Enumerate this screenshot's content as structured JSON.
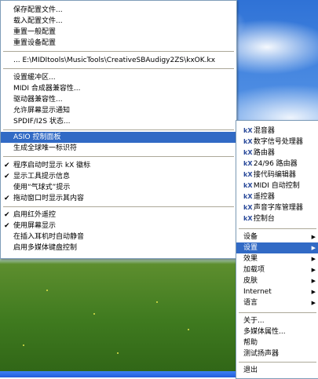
{
  "left_menu": {
    "items": [
      {
        "label": "保存配置文件..."
      },
      {
        "label": "载入配置文件..."
      },
      {
        "label": "重置一般配置"
      },
      {
        "label": "重置设备配置"
      },
      {
        "label": "... E:\\MIDItools\\MusicTools\\CreativeSBAudigy2ZS\\kxOK.kx"
      },
      {
        "label": "设置缓冲区..."
      },
      {
        "label": "MIDI 合成器兼容性..."
      },
      {
        "label": "驱动器兼容性..."
      },
      {
        "label": "允许屏幕显示通知"
      },
      {
        "label": "SPDIF/I2S 状态..."
      },
      {
        "label": "ASIO 控制面板",
        "highlighted": true
      },
      {
        "label": "生成全球唯一标识符"
      },
      {
        "label": "程序启动时显示 kX 徽标",
        "checked": true
      },
      {
        "label": "显示工具提示信息",
        "checked": true
      },
      {
        "label": "使用“气球式”提示"
      },
      {
        "label": "拖动窗口时显示其内容",
        "checked": true
      },
      {
        "label": "启用红外遥控",
        "checked": true
      },
      {
        "label": "使用屏幕显示",
        "checked": true
      },
      {
        "label": "在插入耳机时自动静音"
      },
      {
        "label": "启用多媒体键盘控制"
      }
    ]
  },
  "right_menu": {
    "icon_label": "kX",
    "tool_items": [
      {
        "label": "混音器"
      },
      {
        "label": "数字信号处理器"
      },
      {
        "label": "路由器"
      },
      {
        "label": "24/96 路由器"
      },
      {
        "label": "接代码编辑器"
      },
      {
        "label": "MIDI 自动控制"
      },
      {
        "label": "遥控器"
      },
      {
        "label": "声音字库管理器"
      },
      {
        "label": "控制台"
      }
    ],
    "submenu_items": [
      {
        "label": "设备"
      },
      {
        "label": "设置",
        "highlighted": true
      },
      {
        "label": "效果"
      },
      {
        "label": "加载项"
      },
      {
        "label": "皮肤"
      },
      {
        "label": "Internet"
      },
      {
        "label": "语言"
      }
    ],
    "bottom_items": [
      {
        "label": "关于..."
      },
      {
        "label": "多媒体属性..."
      },
      {
        "label": "帮助"
      },
      {
        "label": "测试扬声器"
      },
      {
        "label": "退出"
      }
    ]
  },
  "colors": {
    "highlight": "#316ac5",
    "menu_border": "#7f9db9",
    "separator": "#aca899"
  }
}
